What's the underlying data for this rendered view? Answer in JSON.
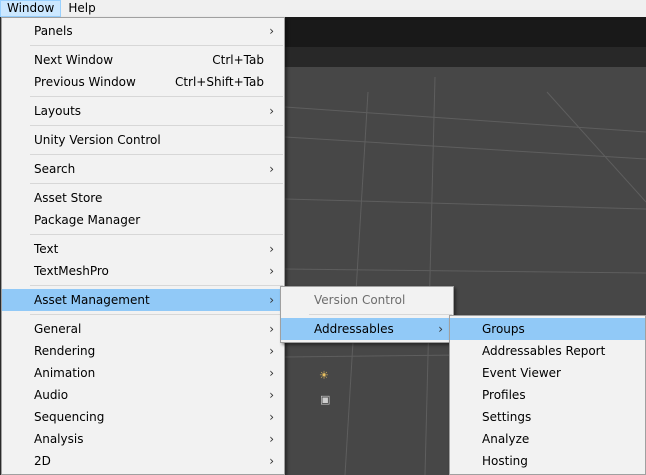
{
  "menubar": {
    "items": [
      "Window",
      "Help"
    ]
  },
  "window_menu": {
    "items": [
      {
        "label": "Panels",
        "arrow": "›"
      },
      {
        "label": "Next Window",
        "shortcut": "Ctrl+Tab"
      },
      {
        "label": "Previous Window",
        "shortcut": "Ctrl+Shift+Tab"
      },
      {
        "label": "Layouts",
        "arrow": "›"
      },
      {
        "label": "Unity Version Control"
      },
      {
        "label": "Search",
        "arrow": "›"
      },
      {
        "label": "Asset Store"
      },
      {
        "label": "Package Manager"
      },
      {
        "label": "Text",
        "arrow": "›"
      },
      {
        "label": "TextMeshPro",
        "arrow": "›"
      },
      {
        "label": "Asset Management",
        "arrow": "›"
      },
      {
        "label": "General",
        "arrow": "›"
      },
      {
        "label": "Rendering",
        "arrow": "›"
      },
      {
        "label": "Animation",
        "arrow": "›"
      },
      {
        "label": "Audio",
        "arrow": "›"
      },
      {
        "label": "Sequencing",
        "arrow": "›"
      },
      {
        "label": "Analysis",
        "arrow": "›"
      },
      {
        "label": "2D",
        "arrow": "›"
      }
    ]
  },
  "asset_management_menu": {
    "items": [
      {
        "label": "Version Control"
      },
      {
        "label": "Addressables",
        "arrow": "›"
      }
    ]
  },
  "addressables_menu": {
    "items": [
      {
        "label": "Groups"
      },
      {
        "label": "Addressables Report"
      },
      {
        "label": "Event Viewer"
      },
      {
        "label": "Profiles"
      },
      {
        "label": "Settings"
      },
      {
        "label": "Analyze"
      },
      {
        "label": "Hosting"
      }
    ]
  },
  "colors": {
    "highlight": "#91c9f7",
    "menu_bg": "#f2f2f2",
    "scene_bg": "#474747"
  },
  "icons": [
    "light-gizmo-icon",
    "camera-gizmo-icon"
  ]
}
